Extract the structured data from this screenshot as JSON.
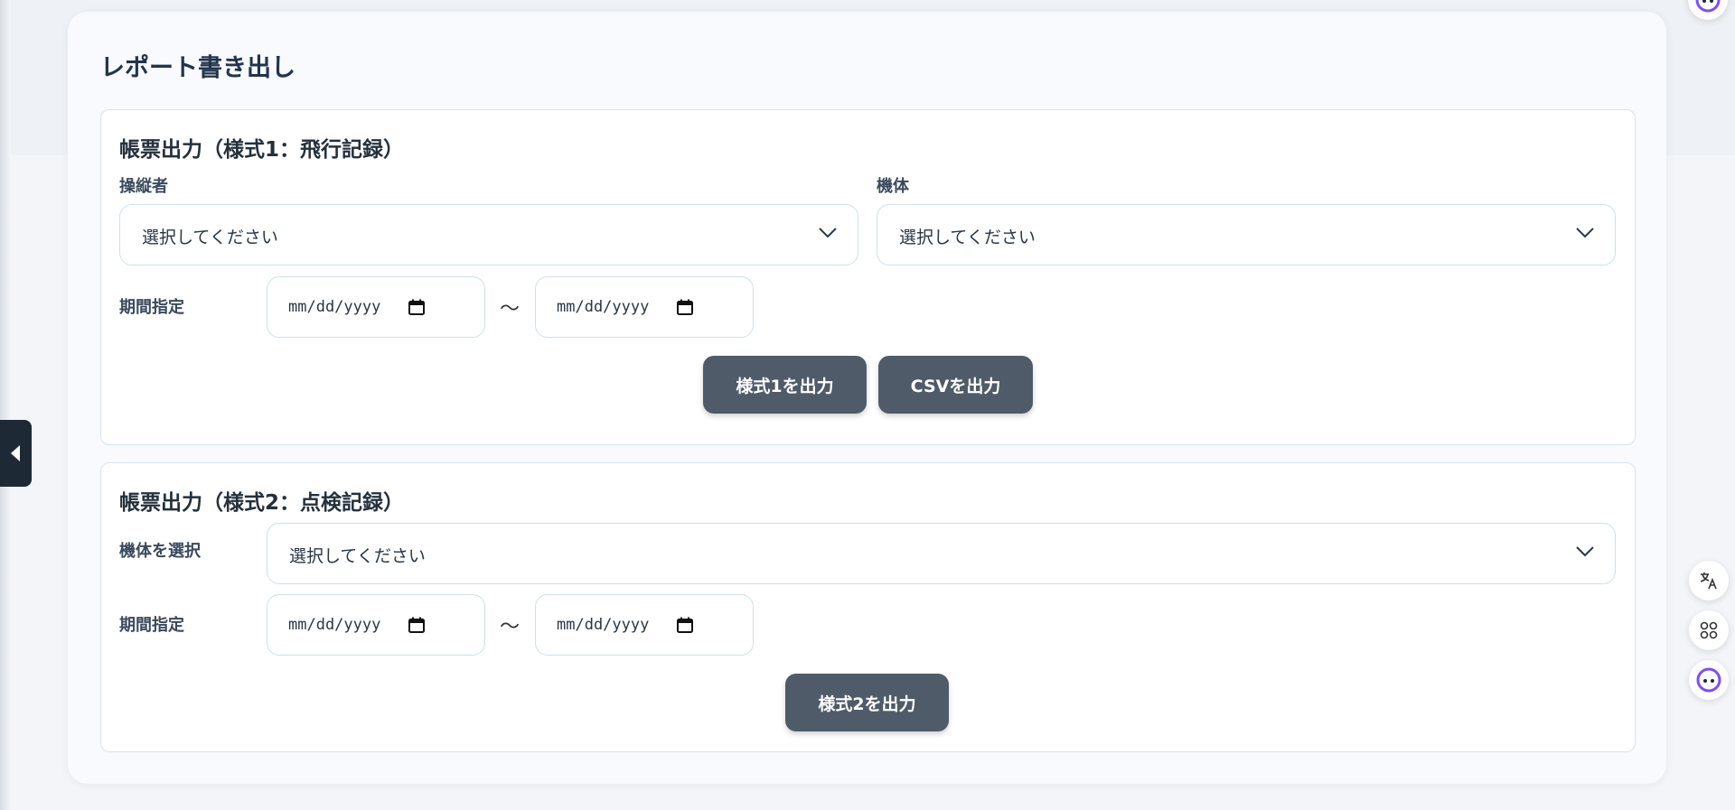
{
  "page_title": "レポート書き出し",
  "section1": {
    "title": "帳票出力（様式1：飛行記録）",
    "operator_label": "操縦者",
    "operator_value": "選択してください",
    "aircraft_label": "機体",
    "aircraft_value": "選択してください",
    "period_label": "期間指定",
    "date_from": "mm/dd/yyyy",
    "date_to": "mm/dd/yyyy",
    "tilde": "〜",
    "export_form1_label": "様式1を出力",
    "export_csv_label": "CSVを出力"
  },
  "section2": {
    "title": "帳票出力（様式2：点検記録）",
    "aircraft_label": "機体を選択",
    "aircraft_value": "選択してください",
    "period_label": "期間指定",
    "date_from": "mm/dd/yyyy",
    "date_to": "mm/dd/yyyy",
    "tilde": "〜",
    "export_form2_label": "様式2を出力"
  },
  "icons": {
    "sidebar_toggle": "caret-left-icon",
    "translate": "translate-icon",
    "apps": "apps-icon",
    "assistant": "assistant-face-icon"
  },
  "colors": {
    "button_bg": "#4f5b68",
    "sidebar_tab_bg": "#1d2a35",
    "accent_purple": "#7c4dff"
  }
}
